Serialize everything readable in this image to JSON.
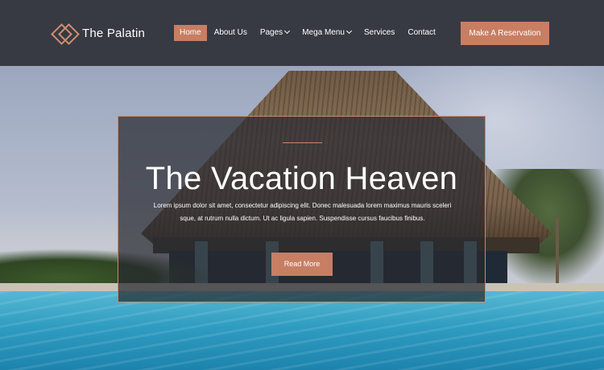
{
  "brand": {
    "name": "The Palatin",
    "icon": "diamond-logo-icon",
    "accent": "#c77e63"
  },
  "nav": {
    "items": [
      {
        "label": "Home",
        "active": true
      },
      {
        "label": "About Us"
      },
      {
        "label": "Pages",
        "dropdown": true
      },
      {
        "label": "Mega Menu",
        "dropdown": true
      },
      {
        "label": "Services"
      },
      {
        "label": "Contact"
      }
    ]
  },
  "header": {
    "cta_label": "Make A Reservation"
  },
  "hero": {
    "title": "The Vacation Heaven",
    "text": "Lorem ipsum dolor sit amet, consectetur adipiscing elit. Donec malesuada lorem maximus mauris sceleri sque, at rutrum nulla dictum. Ut ac ligula sapien. Suspendisse cursus faucibus finibus.",
    "button_label": "Read More"
  }
}
